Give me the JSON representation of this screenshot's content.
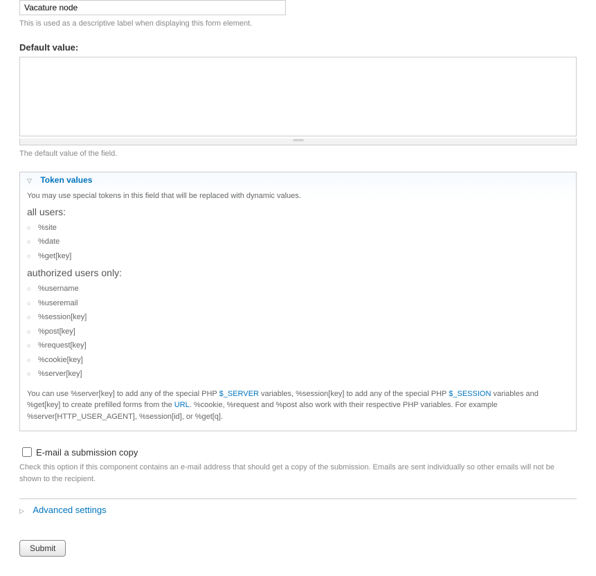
{
  "label_field": {
    "value": "Vacature node",
    "description": "This is used as a descriptive label when displaying this form element."
  },
  "default_value": {
    "label": "Default value:",
    "value": "",
    "description": "The default value of the field."
  },
  "token_fieldset": {
    "legend": "Token values",
    "intro": "You may use special tokens in this field that will be replaced with dynamic values.",
    "group_all_label": "all users:",
    "tokens_all": [
      "%site",
      "%date",
      "%get[key]"
    ],
    "group_auth_label": "authorized users only:",
    "tokens_auth": [
      "%username",
      "%useremail",
      "%session[key]",
      "%post[key]",
      "%request[key]",
      "%cookie[key]",
      "%server[key]"
    ],
    "help_pre": "You can use %server[key] to add any of the special PHP ",
    "help_link1": "$_SERVER",
    "help_mid": " variables, %session[key] to add any of the special PHP ",
    "help_link2": "$_SESSION",
    "help_post1": " variables and %get[key] to create prefilled forms from the ",
    "help_link3": "URL",
    "help_post2": ". %cookie, %request and %post also work with their respective PHP variables. For example %server[HTTP_USER_AGENT], %session[id], or %get[q]."
  },
  "email_copy": {
    "label": "E-mail a submission copy",
    "description": "Check this option if this component contains an e-mail address that should get a copy of the submission. Emails are sent individually so other emails will not be shown to the recipient."
  },
  "advanced": {
    "label": "Advanced settings"
  },
  "submit": {
    "label": "Submit"
  }
}
